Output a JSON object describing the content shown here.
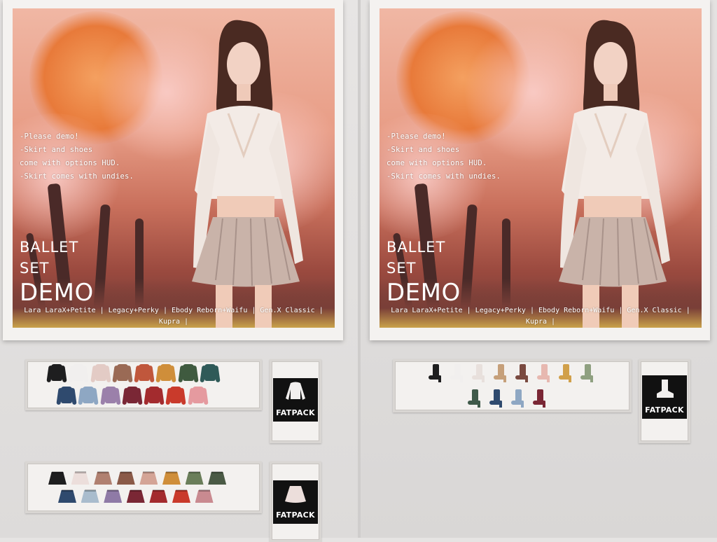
{
  "poster": {
    "note_lines": "-Please demo!\n-Skirt and shoes\ncome with options HUD.\n-Skirt comes with undies.",
    "title_line1": "BALLET",
    "title_line2": "SET",
    "title_line3": "DEMO",
    "bodies": "Lara LaraX+Petite | Legacy+Perky | Ebody Reborn+Waifu | Gen.X Classic | Kupra |"
  },
  "tops_shelf": {
    "row1": [
      "#1e1e1f",
      "#f1efee",
      "#e3cbc5",
      "#9a6a55",
      "#c0573c",
      "#cf8e3a",
      "#3f5a3f",
      "#2f5a58"
    ],
    "row2": [
      "#2f4a6e",
      "#8ea7c3",
      "#9b80aa",
      "#7a2735",
      "#a32b2e",
      "#c93a2b",
      "#e59a9f"
    ]
  },
  "skirts_shelf": {
    "row1": [
      "#1e1e1f",
      "#ecdedb",
      "#b08070",
      "#8a5a48",
      "#d4a496",
      "#cf8e3a",
      "#6a7e5a",
      "#4a5a45"
    ],
    "row2": [
      "#2f4a6e",
      "#a9bccd",
      "#8f7aa6",
      "#7a2735",
      "#a32b2e",
      "#c93a2b",
      "#c98a90"
    ]
  },
  "shoes_shelf": {
    "row1": [
      "#1e1e1f",
      "#f1efee",
      "#e8e0dc",
      "#c6a07a",
      "#7a4a40",
      "#e7b8b0",
      "#d1a04a",
      "#8fa080"
    ],
    "row2": [
      "#3f5a4a",
      "#2f4a6e",
      "#8ea7c3",
      "#7a2735"
    ]
  },
  "fatpack": {
    "tops_label": "FATPACK",
    "skirts_label": "FATPACK",
    "shoes_label": "FATPACK"
  }
}
